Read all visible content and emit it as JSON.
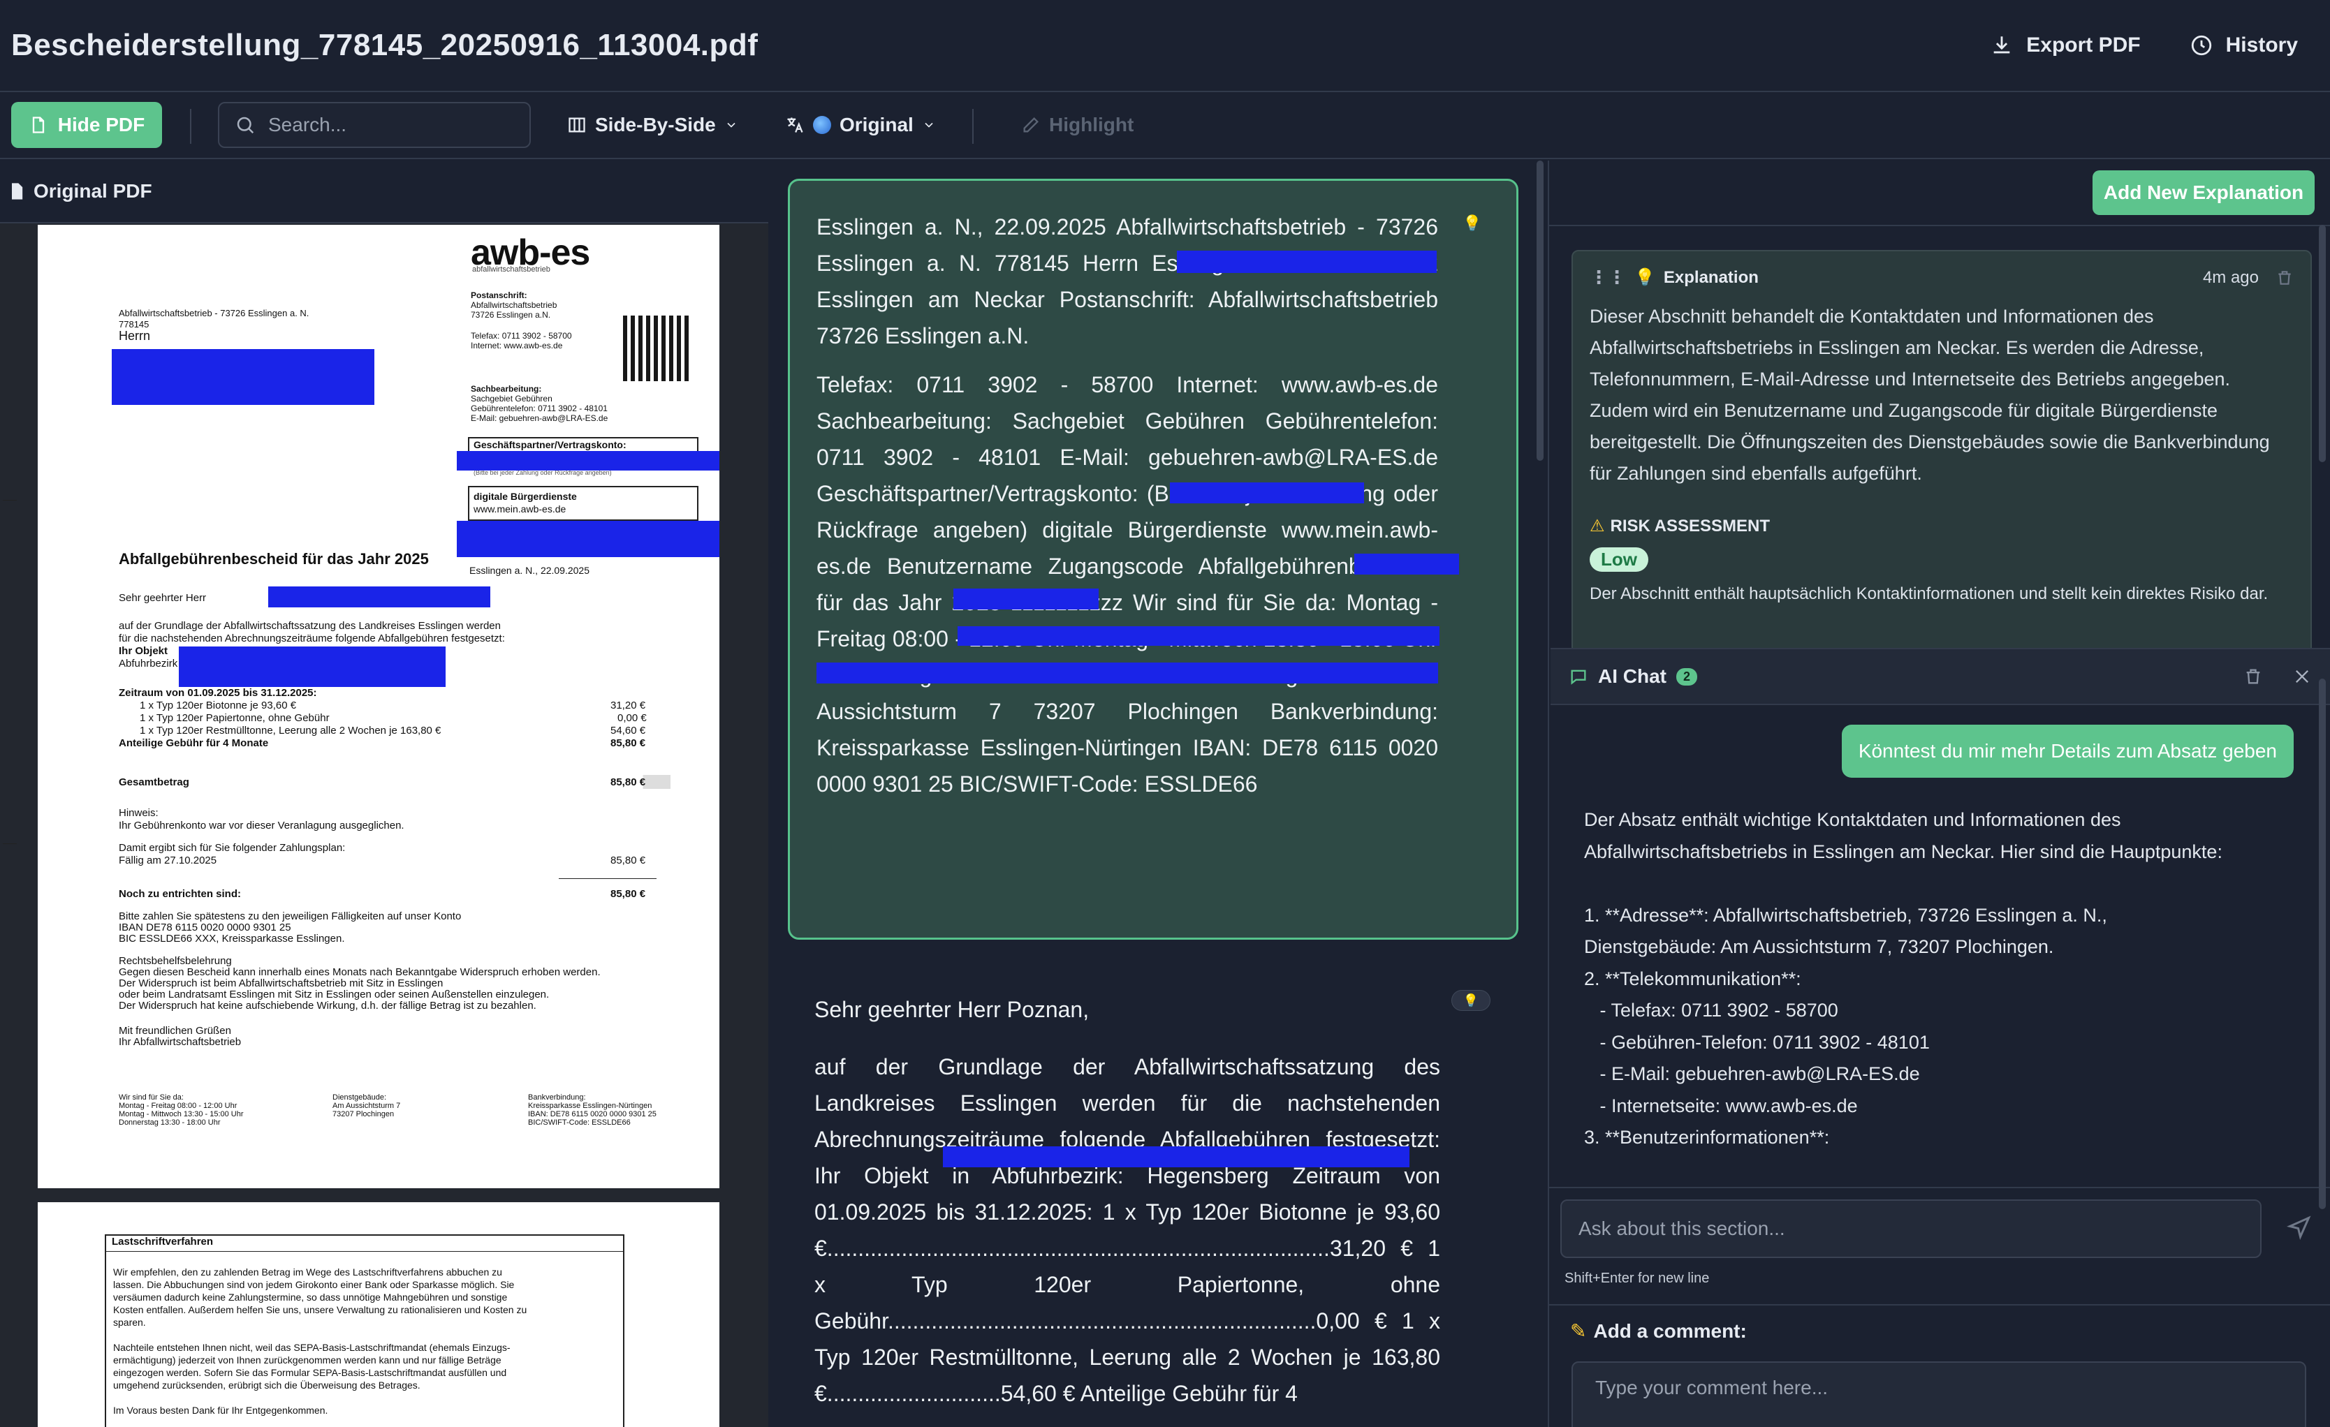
{
  "header": {
    "title": "Bescheiderstellung_778145_20250916_113004.pdf",
    "export_label": "Export PDF",
    "history_label": "History"
  },
  "toolbar": {
    "hide_pdf_label": "Hide PDF",
    "search_placeholder": "Search...",
    "view_mode_label": "Side-By-Side",
    "language_label": "Original",
    "highlight_label": "Highlight"
  },
  "left": {
    "heading": "Original PDF",
    "page1": {
      "logo": "awb-es",
      "logo_sub": "abfallwirtschaftsbetrieb",
      "sender_line": "Abfallwirtschaftsbetrieb - 73726 Esslingen a. N.",
      "ref": "778145",
      "salutation": "Herrn",
      "postanschrift_head": "Postanschrift:",
      "postanschrift_1": "Abfallwirtschaftsbetrieb",
      "postanschrift_2": "73726 Esslingen a.N.",
      "tel": "Telefax: 0711 3902 - 58700",
      "web": "Internet: www.awb-es.de",
      "sach_head": "Sachbearbeitung:",
      "sach_1": "Sachgebiet Gebühren",
      "sach_2": "Gebührentelefon: 0711 3902 - 48101",
      "sach_3": "E-Mail: gebuehren-awb@LRA-ES.de",
      "gp_head": "Geschäftspartner/Vertragskonto:",
      "gp_hint": "(Bitte bei jeder Zahlung oder Rückfrage angeben)",
      "db_head": "digitale Bürgerdienste",
      "db_url": "www.mein.awb-es.de",
      "date": "Esslingen a. N., 22.09.2025",
      "doc_heading": "Abfallgebührenbescheid für das Jahr 2025",
      "dear": "Sehr geehrter Herr",
      "intro_1": "auf der Grundlage der Abfallwirtschaftssatzung des Landkreises Esslingen werden",
      "intro_2": "für die nachstehenden Abrechnungszeiträume folgende Abfallgebühren festgesetzt:",
      "object": "Ihr Objekt",
      "district": "Abfuhrbezirk",
      "period": "Zeitraum von 01.09.2025 bis 31.12.2025:",
      "item1": "1 x Typ 120er Biotonne je 93,60 €",
      "item1_val": "31,20  €",
      "item2": "1 x Typ 120er Papiertonne, ohne Gebühr",
      "item2_val": "0,00  €",
      "item3": "1 x Typ 120er Restmülltonne, Leerung alle 2 Wochen je 163,80 €",
      "item3_val": "54,60  €",
      "share": "Anteilige Gebühr für 4 Monate",
      "share_val": "85,80  €",
      "total": "Gesamtbetrag",
      "total_val": "85,80  €",
      "note_head": "Hinweis:",
      "note_1": "Ihr Gebührenkonto war vor dieser Veranlagung ausgeglichen.",
      "plan": "Damit ergibt sich für Sie folgender Zahlungsplan:",
      "due": "Fällig am 27.10.2025",
      "due_val": "85,80  €",
      "open": "Noch zu entrichten sind:",
      "open_val": "85,80  €",
      "pay_1": "Bitte zahlen Sie spätestens zu den jeweiligen Fälligkeiten auf unser Konto",
      "pay_2": "IBAN DE78 6115 0020 0000 9301 25",
      "pay_3": "BIC ESSLDE66 XXX, Kreissparkasse Esslingen.",
      "legal_head": "Rechtsbehelfsbelehrung",
      "legal_1": "Gegen diesen Bescheid kann innerhalb eines Monats nach Bekanntgabe Widerspruch erhoben werden.",
      "legal_2": "Der Widerspruch ist beim Abfallwirtschaftsbetrieb mit Sitz in Esslingen",
      "legal_3": "oder beim Landratsamt Esslingen mit Sitz in Esslingen oder seinen Außenstellen einzulegen.",
      "legal_4": "Der Widerspruch hat keine aufschiebende Wirkung, d.h. der fällige Betrag ist zu bezahlen.",
      "greet_1": "Mit freundlichen Grüßen",
      "greet_2": "Ihr Abfallwirtschaftsbetrieb",
      "foot_hours_head": "Wir sind für Sie da:",
      "foot_hours_1": "Montag - Freitag      08:00 - 12:00 Uhr",
      "foot_hours_2": "Montag - Mittwoch   13:30 - 15:00 Uhr",
      "foot_hours_3": "Donnerstag              13:30 - 18:00 Uhr",
      "foot_building_head": "Dienstgebäude:",
      "foot_building_1": "Am Aussichtsturm 7",
      "foot_building_2": "73207 Plochingen",
      "foot_bank_head": "Bankverbindung:",
      "foot_bank_1": "Kreissparkasse Esslingen-Nürtingen",
      "foot_bank_2": "IBAN: DE78 6115 0020 0000 9301 25",
      "foot_bank_3": "BIC/SWIFT-Code: ESSLDE66"
    },
    "page2": {
      "box_head": "Lastschriftverfahren",
      "para1_1": "Wir empfehlen, den zu zahlenden Betrag im Wege des Lastschriftverfahrens abbuchen zu",
      "para1_2": "lassen. Die Abbuchungen sind von jedem Girokonto einer Bank oder Sparkasse möglich. Sie",
      "para1_3": "versäumen dadurch keine Zahlungstermine, so dass unnötige Mahngebühren und sonstige",
      "para1_4": "Kosten entfallen. Außerdem helfen Sie uns, unsere Verwaltung zu rationalisieren und Kosten zu",
      "para1_5": "sparen.",
      "para2_1": "Nachteile entstehen Ihnen nicht, weil das SEPA-Basis-Lastschriftmandat (ehemals Einzugs-",
      "para2_2": "ermächtigung) jederzeit von Ihnen zurückgenommen werden kann und nur fällige Beträge",
      "para2_3": "eingezogen werden. Sofern Sie das Formular SEPA-Basis-Lastschriftmandat ausfüllen und",
      "para2_4": "umgehend zurücksenden, erübrigt sich die Überweisung des Betrages.",
      "para3": "Im Voraus besten Dank für Ihr Entgegenkommen."
    }
  },
  "middle": {
    "segment1": {
      "p1": "Esslingen a. N., 22.09.2025 Abfallwirtschaftsbetrieb - 73726 Esslingen a. N. 778145 Herrn                                    Esslinger Straße 87 73732 Esslingen am Neckar Postanschrift: Abfallwirtschaftsbetrieb 73726 Esslingen a.N.",
      "p2": "Telefax: 0711 3902 - 58700 Internet: www.awb-es.de Sachbearbeitung: Sachgebiet Gebühren Gebührentelefon: 0711 3902 - 48101 E-Mail: gebuehren-awb@LRA-ES.de Geschäftspartner/Vertragskonto:                              (Bitte bei jeder Zahlung oder Rückfrage angeben) digitale Bürgerdienste www.mein.awb-es.de Benutzername                   Zugangscode                             Abfallgebührenbescheid für das Jahr 2025                                                                                                                                    zzzzzzzzzz Wir sind für Sie da: Montag - Freitag 08:00 - 12:00 Uhr Montag - Mittwoch 13:30 - 15:00 Uhr Donnerstag 13:30 - 18:00 Uhr Dienstgebäude: Am Aussichtsturm 7 73207 Plochingen Bankverbindung: Kreissparkasse Esslingen-Nürtingen IBAN: DE78 6115 0020 0000 9301 25 BIC/SWIFT-Code: ESSLDE66"
    },
    "segment2": {
      "p1": "Sehr geehrter Herr Poznan,",
      "p2": "auf der Grundlage der Abfallwirtschaftssatzung des Landkreises Esslingen werden für die nachstehenden Abrechnungszeiträume folgende Abfallgebühren festgesetzt: Ihr Objekt in                                                      Abfuhrbezirk: Hegensberg Zeitraum von 01.09.2025 bis 31.12.2025: 1 x Typ 120er Biotonne je 93,60 €.................................................................................31,20 € 1 x Typ 120er Papiertonne, ohne Gebühr.....................................................................0,00 € 1 x Typ 120er Restmülltonne, Leerung alle 2 Wochen je 163,80 €............................54,60 € Anteilige Gebühr für 4"
    }
  },
  "right": {
    "add_button": "Add New Explanation",
    "explanation": {
      "label": "Explanation",
      "time": "4m ago",
      "body": "Dieser Abschnitt behandelt die Kontaktdaten und Informationen des Abfallwirtschaftsbetriebs in Esslingen am Neckar. Es werden die Adresse, Telefonnummern, E-Mail-Adresse und Internetseite des Betriebs angegeben. Zudem wird ein Benutzername und Zugangscode für digitale Bürgerdienste bereitgestellt. Die Öffnungszeiten des Dienstgebäudes sowie die Bankverbindung für Zahlungen sind ebenfalls aufgeführt.",
      "risk_label": "RISK ASSESSMENT",
      "risk_level": "Low",
      "risk_text": "Der Abschnitt enthält hauptsächlich Kontaktinformationen und stellt kein direktes Risiko dar."
    },
    "chat": {
      "title": "AI Chat",
      "count": "2",
      "user_message": "Könntest du mir mehr Details zum Absatz geben",
      "ai_message": "Der Absatz enthält wichtige Kontaktdaten und Informationen des Abfallwirtschaftsbetriebs in Esslingen am Neckar. Hier sind die Hauptpunkte:\n\n1. **Adresse**: Abfallwirtschaftsbetrieb, 73726 Esslingen a. N.,\nDienstgebäude: Am Aussichtsturm 7, 73207 Plochingen.\n2. **Telekommunikation**:\n   - Telefax: 0711 3902 - 58700\n   - Gebühren-Telefon: 0711 3902 - 48101\n   - E-Mail: gebuehren-awb@LRA-ES.de\n   - Internetseite: www.awb-es.de\n3. **Benutzerinformationen**:",
      "input_placeholder": "Ask about this section...",
      "hint": "Shift+Enter for new line"
    },
    "comment": {
      "label": "Add a comment:",
      "placeholder": "Type your comment here..."
    }
  }
}
